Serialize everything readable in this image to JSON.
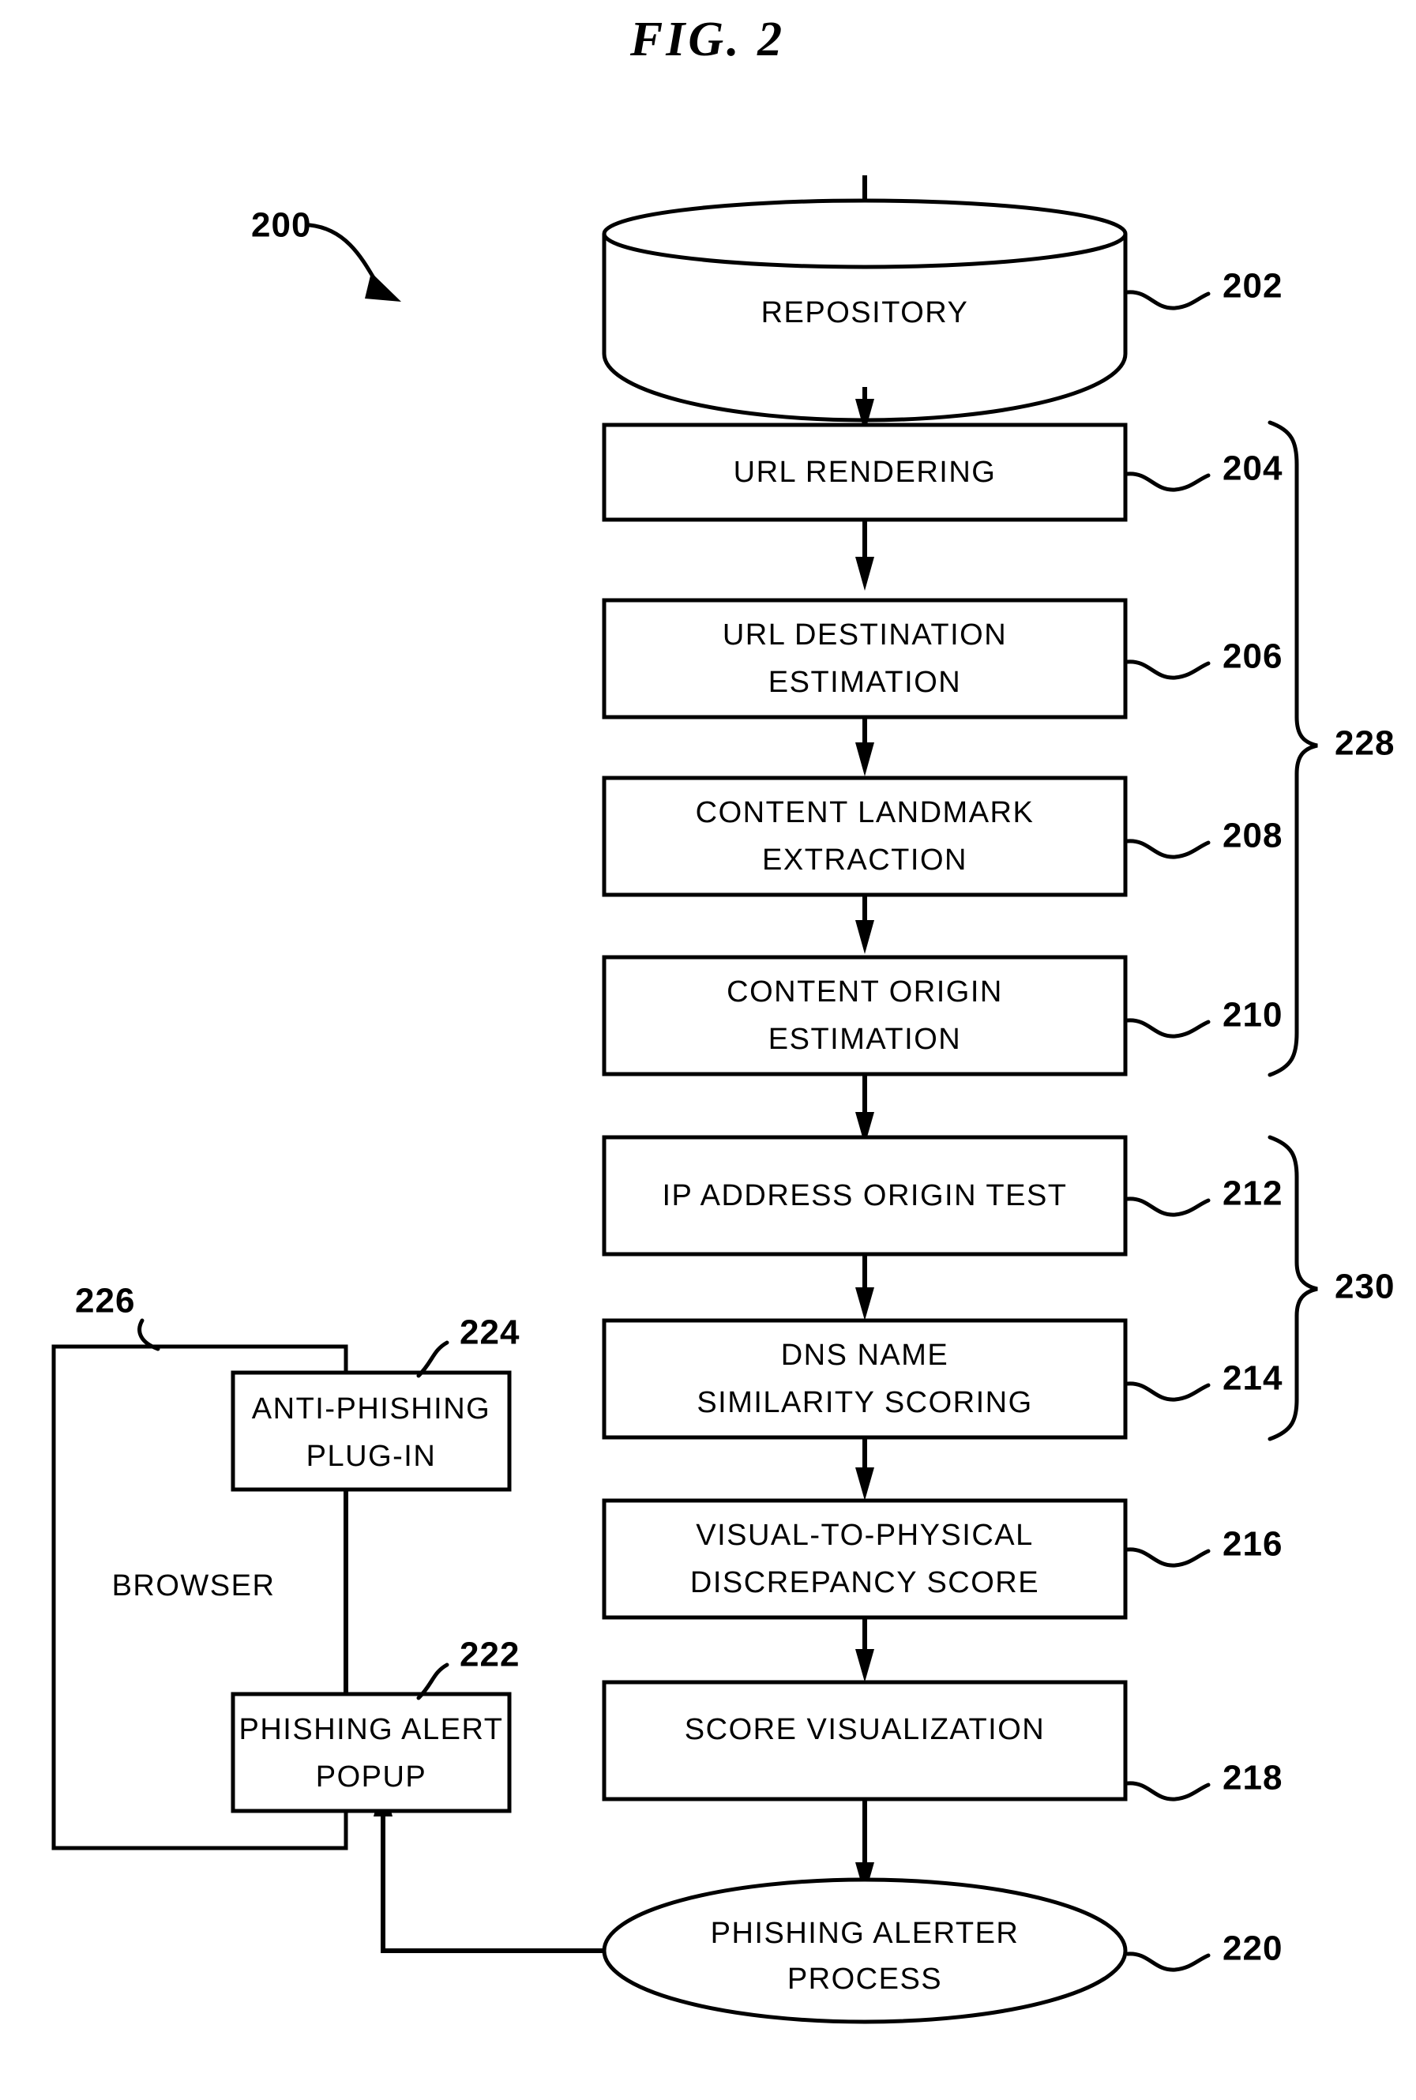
{
  "figure": {
    "title": "FIG.  2",
    "diagram_ref": "200"
  },
  "nodes": {
    "repository": {
      "label": "REPOSITORY",
      "ref": "202",
      "shape": "cylinder"
    },
    "url_rendering": {
      "label": "URL  RENDERING",
      "ref": "204",
      "shape": "rect"
    },
    "url_destination": {
      "line1": "URL  DESTINATION",
      "line2": "ESTIMATION",
      "ref": "206",
      "shape": "rect"
    },
    "content_landmark": {
      "line1": "CONTENT  LANDMARK",
      "line2": "EXTRACTION",
      "ref": "208",
      "shape": "rect"
    },
    "content_origin": {
      "line1": "CONTENT  ORIGIN",
      "line2": "ESTIMATION",
      "ref": "210",
      "shape": "rect"
    },
    "ip_address_origin": {
      "label": "IP ADDRESS ORIGIN TEST",
      "ref": "212",
      "shape": "rect"
    },
    "dns_similarity": {
      "line1": "DNS  NAME",
      "line2": "SIMILARITY  SCORING",
      "ref": "214",
      "shape": "rect"
    },
    "visual_physical": {
      "line1": "VISUAL-TO-PHYSICAL",
      "line2": "DISCREPANCY  SCORE",
      "ref": "216",
      "shape": "rect"
    },
    "score_visualization": {
      "label": "SCORE  VISUALIZATION",
      "ref": "218",
      "shape": "rect"
    },
    "phishing_alerter": {
      "line1": "PHISHING  ALERTER",
      "line2": "PROCESS",
      "ref": "220",
      "shape": "ellipse"
    },
    "browser": {
      "label": "BROWSER",
      "ref": "226",
      "shape": "rect"
    },
    "anti_phishing_plugin": {
      "line1": "ANTI-PHISHING",
      "line2": "PLUG-IN",
      "ref": "224",
      "shape": "rect"
    },
    "phishing_alert_popup": {
      "line1": "PHISHING  ALERT",
      "line2": "POPUP",
      "ref": "222",
      "shape": "rect"
    }
  },
  "groups": {
    "upper_brace": {
      "ref": "228",
      "covers": [
        "204",
        "206",
        "208",
        "210"
      ]
    },
    "lower_brace": {
      "ref": "230",
      "covers": [
        "212",
        "214"
      ]
    }
  },
  "colors": {
    "stroke": "#000000",
    "fill": "#ffffff",
    "background": "#ffffff"
  }
}
